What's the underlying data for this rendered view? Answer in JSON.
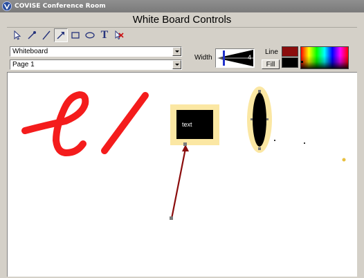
{
  "window": {
    "title": "COVISE Conference Room"
  },
  "panel": {
    "title": "White Board Controls"
  },
  "toolbar": {
    "tools": [
      {
        "id": "select",
        "icon": "pointer-icon"
      },
      {
        "id": "pen",
        "icon": "pen-icon"
      },
      {
        "id": "line",
        "icon": "line-icon"
      },
      {
        "id": "arrow",
        "icon": "arrow-icon",
        "active": true
      },
      {
        "id": "rectangle",
        "icon": "rectangle-icon"
      },
      {
        "id": "ellipse",
        "icon": "ellipse-icon"
      },
      {
        "id": "text",
        "icon": "text-icon",
        "glyph": "T"
      },
      {
        "id": "delete",
        "icon": "delete-pointer-icon"
      }
    ]
  },
  "controls": {
    "document": {
      "selected": "Whiteboard"
    },
    "page": {
      "selected": "Page 1"
    },
    "width": {
      "label": "Width",
      "value": "4"
    },
    "line_label": "Line",
    "fill_label": "Fill",
    "line_color": "#8b0d0d",
    "fill_color": "#000000"
  },
  "whiteboard": {
    "text_box": {
      "label": "text",
      "border_color": "#fbe7a3",
      "fill_color": "#000000"
    },
    "stroke_color": "#f41c1c",
    "arrow_color": "#8b0d0d",
    "ellipse": {
      "border_color": "#fbe7a3",
      "fill_color": "#000000"
    }
  }
}
